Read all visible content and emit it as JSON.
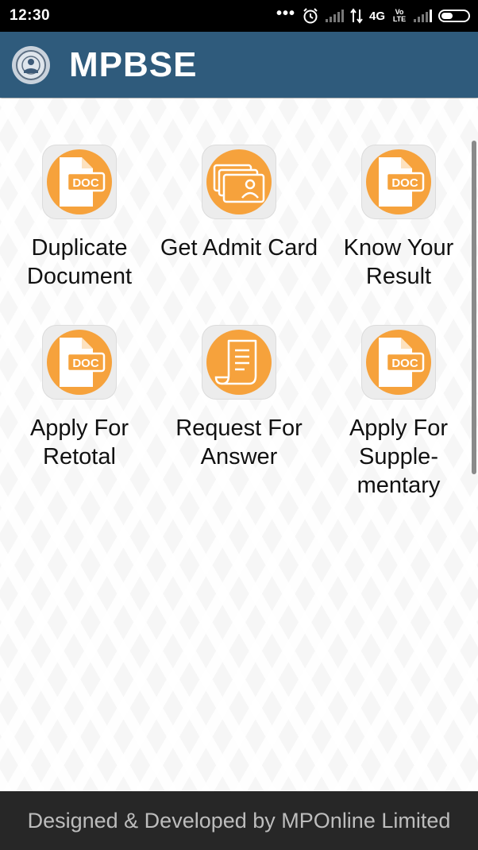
{
  "status_bar": {
    "time": "12:30",
    "network": "4G",
    "volte": "Vo LTE"
  },
  "app_bar": {
    "title": "MPBSE",
    "logo_icon": "mpbse-emblem-icon"
  },
  "tiles": [
    {
      "label": "Duplicate Document",
      "icon": "doc-file-icon"
    },
    {
      "label": "Get Admit Card",
      "icon": "id-card-icon"
    },
    {
      "label": "Know Your Result",
      "icon": "doc-file-icon"
    },
    {
      "label": "Apply For Retotal",
      "icon": "doc-file-icon"
    },
    {
      "label": "Request For Answer",
      "icon": "scroll-document-icon"
    },
    {
      "label": "Apply For Supple- mentary",
      "icon": "doc-file-icon"
    }
  ],
  "footer": {
    "text": "Designed & Developed by MPOnline Limited"
  },
  "colors": {
    "app_bar": "#2f5b7c",
    "icon_orange": "#f6a23c",
    "footer": "#272727"
  }
}
